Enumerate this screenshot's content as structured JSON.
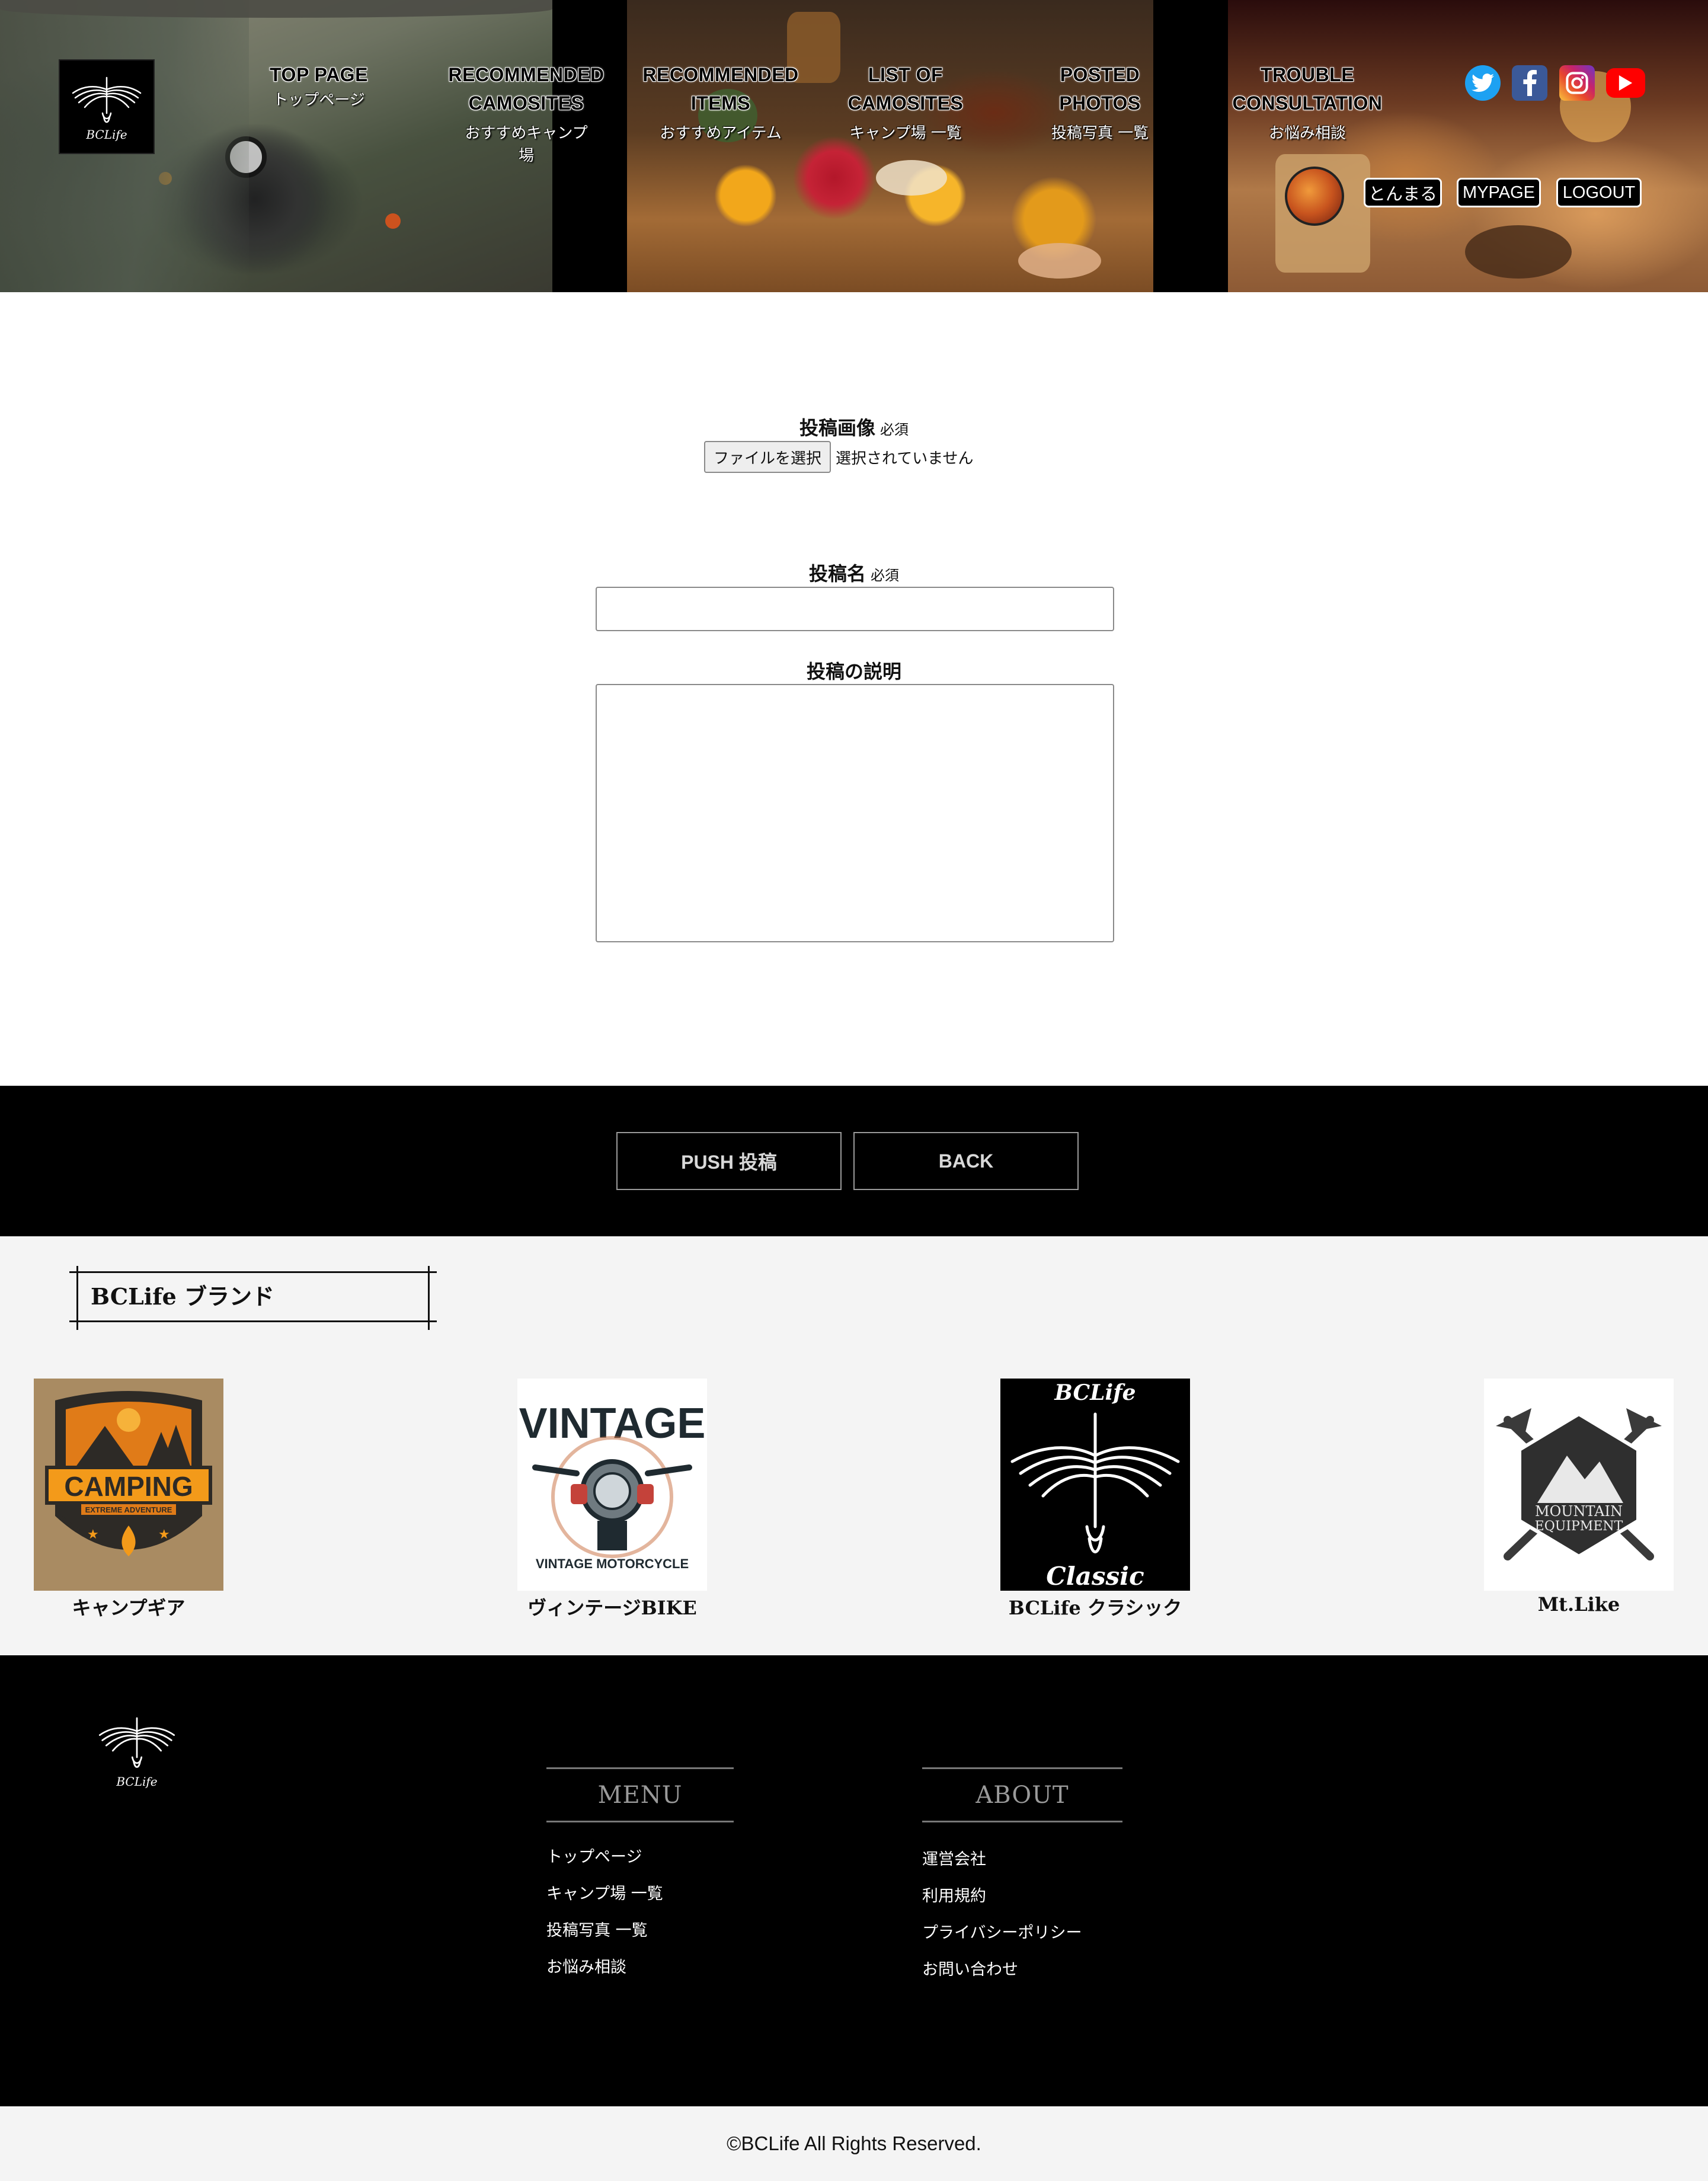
{
  "header": {
    "logo_text": "BCLife",
    "nav": [
      {
        "en": "TOP PAGE",
        "ja": "トップページ"
      },
      {
        "en": "RECOMMENDED\nCAMOSITES",
        "ja": "おすすめキャンプ\n場"
      },
      {
        "en": "RECOMMENDED\nITEMS",
        "ja": "おすすめアイテム"
      },
      {
        "en": "LIST OF\nCAMOSITES",
        "ja": "キャンプ場 一覧"
      },
      {
        "en": "POSTED\nPHOTOS",
        "ja": "投稿写真 一覧"
      },
      {
        "en": "TROUBLE\nCONSULTATION",
        "ja": "お悩み相談"
      }
    ],
    "social": [
      "twitter-icon",
      "facebook-icon",
      "instagram-icon",
      "youtube-icon"
    ],
    "user_name": "とんまる",
    "mypage_label": "MYPAGE",
    "logout_label": "LOGOUT"
  },
  "form": {
    "image_label": "投稿画像",
    "required_mark": "必須",
    "file_button": "ファイルを選択",
    "file_status": "選択されていません",
    "title_label": "投稿名",
    "title_value": "",
    "description_label": "投稿の説明",
    "description_value": ""
  },
  "actions": {
    "push_label": "PUSH 投稿",
    "back_label": "BACK"
  },
  "brands": {
    "title": "BCLife ブランド",
    "items": [
      {
        "name": "キャンプギア",
        "logo_lines": [
          "CAMPING",
          "EXTREME ADVENTURE"
        ]
      },
      {
        "name": "ヴィンテージBIKE",
        "logo_lines": [
          "VINTAGE",
          "VINTAGE MOTORCYCLE"
        ]
      },
      {
        "name": "BCLife クラシック",
        "logo_lines": [
          "BCLife",
          "Classic"
        ]
      },
      {
        "name": "Mt.Like",
        "logo_lines": [
          "MOUNTAIN",
          "EQUIPMENT"
        ]
      }
    ]
  },
  "footer": {
    "logo_text": "BCLife",
    "menu_title": "MENU",
    "menu_links": [
      "トップページ",
      "キャンプ場 一覧",
      "投稿写真 一覧",
      "お悩み相談"
    ],
    "about_title": "ABOUT",
    "about_links": [
      "運営会社",
      "利用規約",
      "プライバシーポリシー",
      "お問い合わせ"
    ],
    "copyright": "©BCLife All Rights Reserved."
  },
  "colors": {
    "twitter": "#1da1f2",
    "facebook": "#3b5998",
    "youtube": "#ff0000",
    "footer_bg": "#000000",
    "light_bg": "#f4f4f4"
  }
}
